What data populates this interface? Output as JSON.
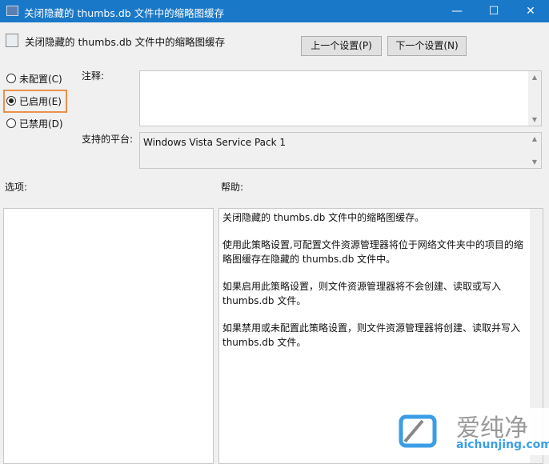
{
  "window": {
    "title": "关闭隐藏的 thumbs.db 文件中的缩略图缓存",
    "minimize": "—",
    "maximize": "☐",
    "close": "✕"
  },
  "header": {
    "policy_title": "关闭隐藏的 thumbs.db 文件中的缩略图缓存",
    "prev_button": "上一个设置(P)",
    "next_button": "下一个设置(N)"
  },
  "state": {
    "options": [
      {
        "label": "未配置(C)",
        "selected": false
      },
      {
        "label": "已启用(E)",
        "selected": true
      },
      {
        "label": "已禁用(D)",
        "selected": false
      }
    ]
  },
  "comment": {
    "label": "注释:",
    "value": ""
  },
  "platform": {
    "label": "支持的平台:",
    "value": "Windows Vista Service Pack 1"
  },
  "options_label": "选项:",
  "help_label": "帮助:",
  "help_paragraphs": [
    "关闭隐藏的 thumbs.db 文件中的缩略图缓存。",
    "使用此策略设置,可配置文件资源管理器将位于网络文件夹中的项目的缩略图缓存在隐藏的 thumbs.db 文件中。",
    "如果启用此策略设置，则文件资源管理器将不会创建、读取或写入 thumbs.db 文件。",
    "如果禁用或未配置此策略设置，则文件资源管理器将创建、读取并写入 thumbs.db 文件。"
  ],
  "watermark": {
    "text": "爱纯净",
    "url": "aichunjing.com"
  },
  "colors": {
    "titlebar": "#1a78c8",
    "highlight": "#e8914a"
  }
}
